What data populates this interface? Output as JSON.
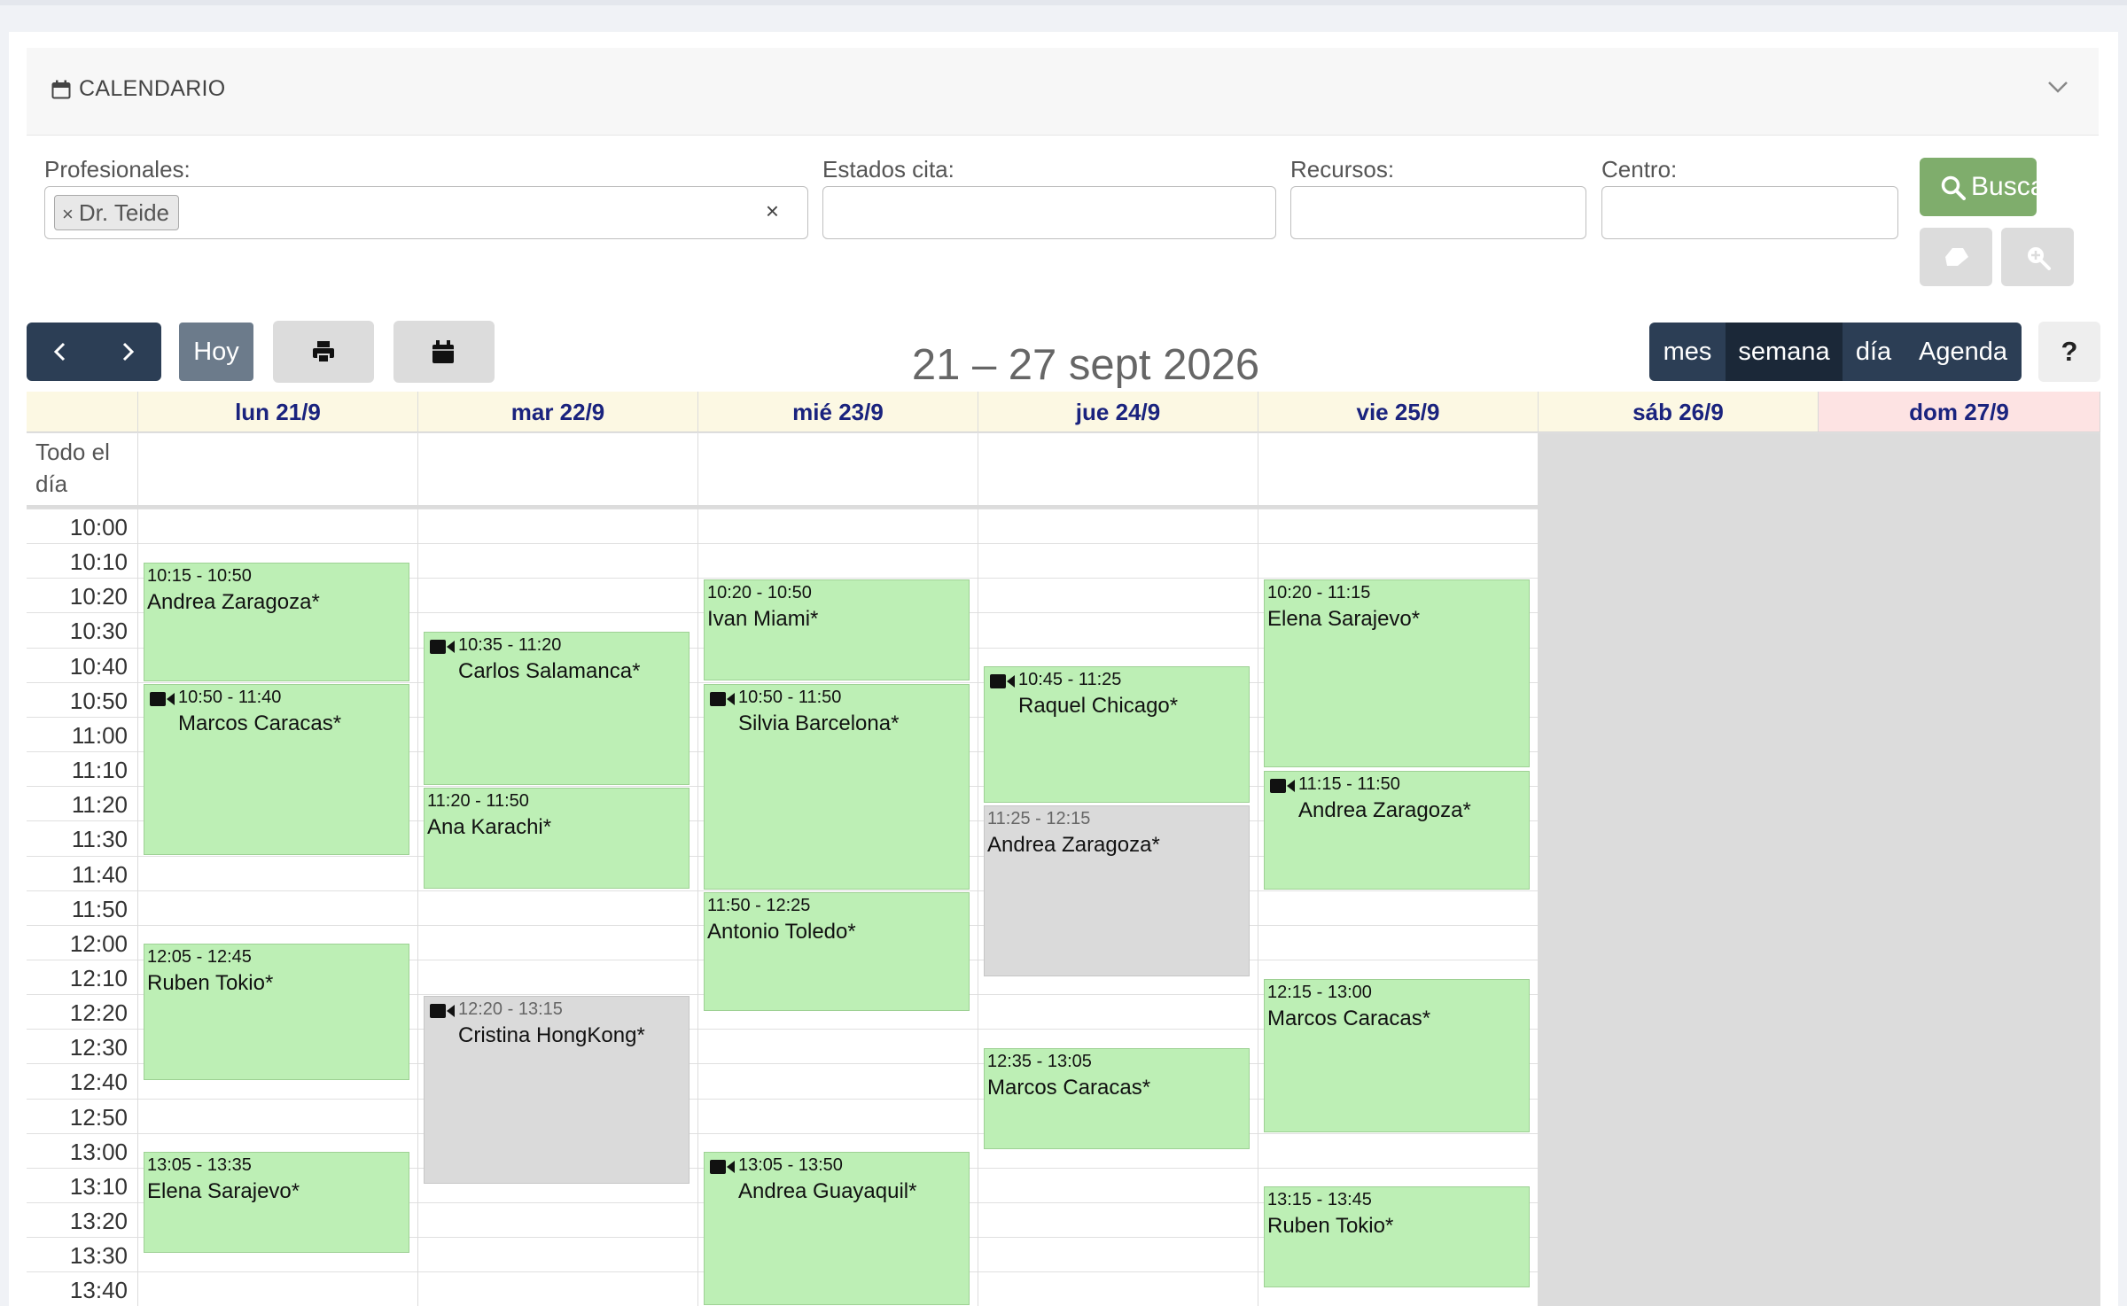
{
  "header": {
    "title": "CALENDARIO"
  },
  "filters": {
    "profesionales_label": "Profesionales:",
    "profesionales_chip": "Dr. Teide",
    "chip_remove": "×",
    "clear": "×",
    "estados_label": "Estados cita:",
    "recursos_label": "Recursos:",
    "centro_label": "Centro:",
    "buscar_label": "Buscar"
  },
  "toolbar": {
    "today_label": "Hoy",
    "period_title": "21 – 27 sept 2026",
    "views": [
      "mes",
      "semana",
      "día",
      "Agenda"
    ],
    "active_view": "semana",
    "help_label": "?"
  },
  "calendar": {
    "all_day_label": "Todo el día",
    "days": [
      "lun 21/9",
      "mar 22/9",
      "mié 23/9",
      "jue 24/9",
      "vie 25/9",
      "sáb 26/9",
      "dom 27/9"
    ],
    "times": [
      "10:00",
      "10:10",
      "10:20",
      "10:30",
      "10:40",
      "10:50",
      "11:00",
      "11:10",
      "11:20",
      "11:30",
      "11:40",
      "11:50",
      "12:00",
      "12:10",
      "12:20",
      "12:30",
      "12:40",
      "12:50",
      "13:00",
      "13:10",
      "13:20",
      "13:30",
      "13:40"
    ],
    "colors": {
      "header_bg": "#fcf8e3",
      "sunday_bg": "#fde3e3",
      "event_green": "#bdefb5",
      "event_gray": "#dadada",
      "weekend_bg": "#dcdcdc"
    },
    "events": [
      {
        "day": 0,
        "start": "10:15",
        "end": "10:50",
        "time": "10:15 - 10:50",
        "name": "Andrea Zaragoza*",
        "video": false,
        "status": "green"
      },
      {
        "day": 0,
        "start": "10:50",
        "end": "11:40",
        "time": "10:50 - 11:40",
        "name": "Marcos Caracas*",
        "video": true,
        "status": "green"
      },
      {
        "day": 0,
        "start": "12:05",
        "end": "12:45",
        "time": "12:05 - 12:45",
        "name": "Ruben Tokio*",
        "video": false,
        "status": "green"
      },
      {
        "day": 0,
        "start": "13:05",
        "end": "13:35",
        "time": "13:05 - 13:35",
        "name": "Elena Sarajevo*",
        "video": false,
        "status": "green"
      },
      {
        "day": 1,
        "start": "10:35",
        "end": "11:20",
        "time": "10:35 - 11:20",
        "name": "Carlos Salamanca*",
        "video": true,
        "status": "green"
      },
      {
        "day": 1,
        "start": "11:20",
        "end": "11:50",
        "time": "11:20 - 11:50",
        "name": "Ana Karachi*",
        "video": false,
        "status": "green"
      },
      {
        "day": 1,
        "start": "12:20",
        "end": "13:15",
        "time": "12:20 - 13:15",
        "name": "Cristina HongKong*",
        "video": true,
        "status": "gray"
      },
      {
        "day": 2,
        "start": "10:20",
        "end": "10:50",
        "time": "10:20 - 10:50",
        "name": "Ivan Miami*",
        "video": false,
        "status": "green"
      },
      {
        "day": 2,
        "start": "10:50",
        "end": "11:50",
        "time": "10:50 - 11:50",
        "name": "Silvia Barcelona*",
        "video": true,
        "status": "green"
      },
      {
        "day": 2,
        "start": "11:50",
        "end": "12:25",
        "time": "11:50 - 12:25",
        "name": "Antonio Toledo*",
        "video": false,
        "status": "green"
      },
      {
        "day": 2,
        "start": "13:05",
        "end": "13:50",
        "time": "13:05 - 13:50",
        "name": "Andrea Guayaquil*",
        "video": true,
        "status": "green"
      },
      {
        "day": 3,
        "start": "10:45",
        "end": "11:25",
        "time": "10:45 - 11:25",
        "name": "Raquel Chicago*",
        "video": true,
        "status": "green"
      },
      {
        "day": 3,
        "start": "11:25",
        "end": "12:15",
        "time": "11:25 - 12:15",
        "name": "Andrea Zaragoza*",
        "video": false,
        "status": "gray"
      },
      {
        "day": 3,
        "start": "12:35",
        "end": "13:05",
        "time": "12:35 - 13:05",
        "name": "Marcos Caracas*",
        "video": false,
        "status": "green"
      },
      {
        "day": 4,
        "start": "10:20",
        "end": "11:15",
        "time": "10:20 - 11:15",
        "name": "Elena Sarajevo*",
        "video": false,
        "status": "green"
      },
      {
        "day": 4,
        "start": "11:15",
        "end": "11:50",
        "time": "11:15 - 11:50",
        "name": "Andrea Zaragoza*",
        "video": true,
        "status": "green"
      },
      {
        "day": 4,
        "start": "12:15",
        "end": "13:00",
        "time": "12:15 - 13:00",
        "name": "Marcos Caracas*",
        "video": false,
        "status": "green"
      },
      {
        "day": 4,
        "start": "13:15",
        "end": "13:45",
        "time": "13:15 - 13:45",
        "name": "Ruben Tokio*",
        "video": false,
        "status": "green"
      }
    ]
  }
}
